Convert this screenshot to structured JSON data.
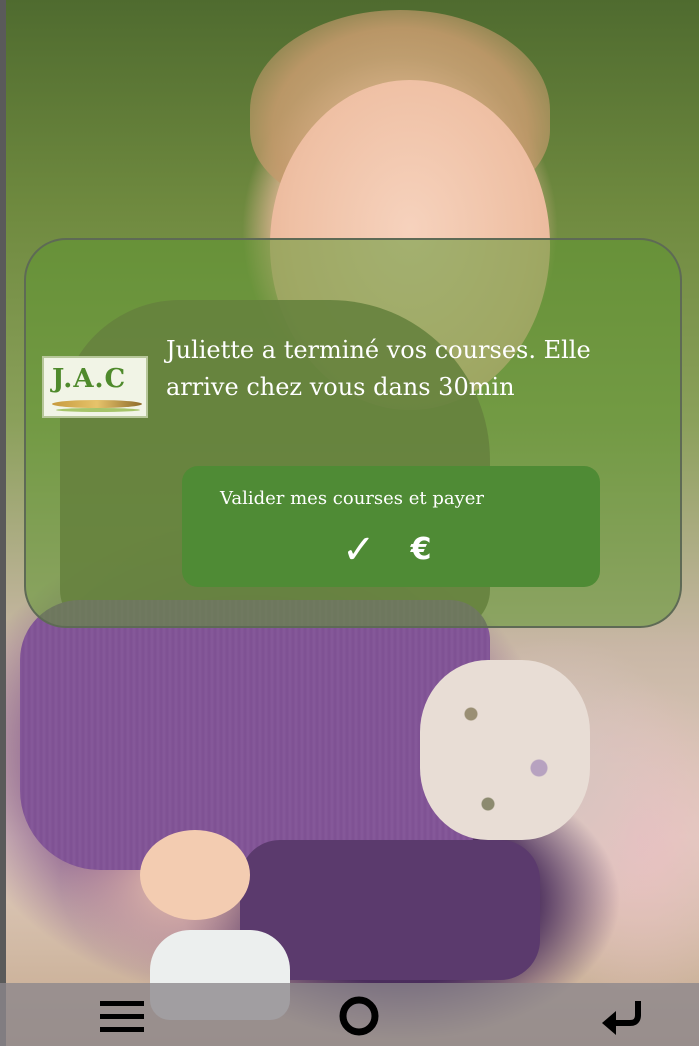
{
  "notification": {
    "logo_text": "J.A.C",
    "message": "Juliette a terminé vos courses. Elle arrive chez vous dans 30min",
    "pay_button": {
      "label": "Valider mes courses et payer",
      "check_symbol": "✓",
      "currency_symbol": "€"
    }
  },
  "navbar": {
    "items": [
      {
        "icon": "menu-icon"
      },
      {
        "icon": "home-circle-icon"
      },
      {
        "icon": "back-arrow-icon"
      }
    ]
  },
  "colors": {
    "card_overlay": "#5f9632",
    "button_green": "#4f8b35",
    "navbar": "#8c878c"
  }
}
